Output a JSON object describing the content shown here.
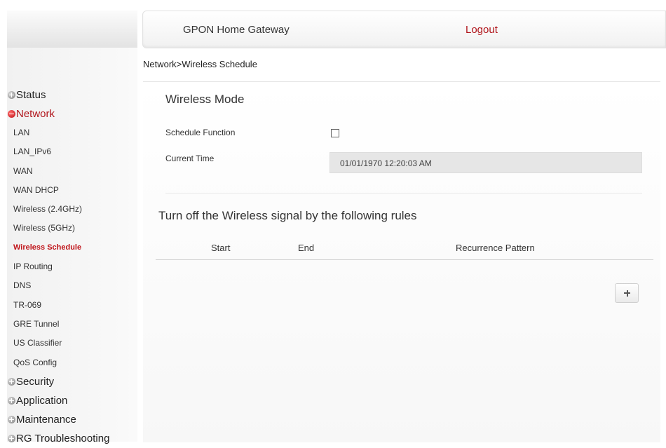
{
  "header": {
    "title": "GPON Home Gateway",
    "logout_label": "Logout"
  },
  "breadcrumb": "Network>Wireless Schedule",
  "sidebar": {
    "items": [
      {
        "label": "Status",
        "type": "section",
        "icon": "plus-bullet-icon"
      },
      {
        "label": "Network",
        "type": "section",
        "icon": "minus-bullet-icon",
        "active": true
      },
      {
        "label": "LAN",
        "type": "sub"
      },
      {
        "label": "LAN_IPv6",
        "type": "sub"
      },
      {
        "label": "WAN",
        "type": "sub"
      },
      {
        "label": "WAN DHCP",
        "type": "sub"
      },
      {
        "label": "Wireless (2.4GHz)",
        "type": "sub"
      },
      {
        "label": "Wireless (5GHz)",
        "type": "sub"
      },
      {
        "label": "Wireless Schedule",
        "type": "sub",
        "active": true
      },
      {
        "label": "IP Routing",
        "type": "sub"
      },
      {
        "label": "DNS",
        "type": "sub"
      },
      {
        "label": "TR-069",
        "type": "sub"
      },
      {
        "label": "GRE Tunnel",
        "type": "sub"
      },
      {
        "label": "US Classifier",
        "type": "sub"
      },
      {
        "label": "QoS Config",
        "type": "sub"
      },
      {
        "label": "Security",
        "type": "section",
        "icon": "plus-bullet-icon"
      },
      {
        "label": "Application",
        "type": "section",
        "icon": "plus-bullet-icon"
      },
      {
        "label": "Maintenance",
        "type": "section",
        "icon": "plus-bullet-icon"
      },
      {
        "label": "RG Troubleshooting",
        "type": "section",
        "icon": "plus-bullet-icon"
      }
    ]
  },
  "wireless_mode": {
    "title": "Wireless Mode",
    "schedule_label": "Schedule Function",
    "schedule_checked": false,
    "current_time_label": "Current Time",
    "current_time_value": "01/01/1970 12:20:03 AM"
  },
  "rules": {
    "title": "Turn off the Wireless signal by the following rules",
    "columns": [
      "Start",
      "End",
      "Recurrence Pattern"
    ],
    "add_button_icon": "plus-icon"
  },
  "colors": {
    "accent": "#b0141a"
  }
}
